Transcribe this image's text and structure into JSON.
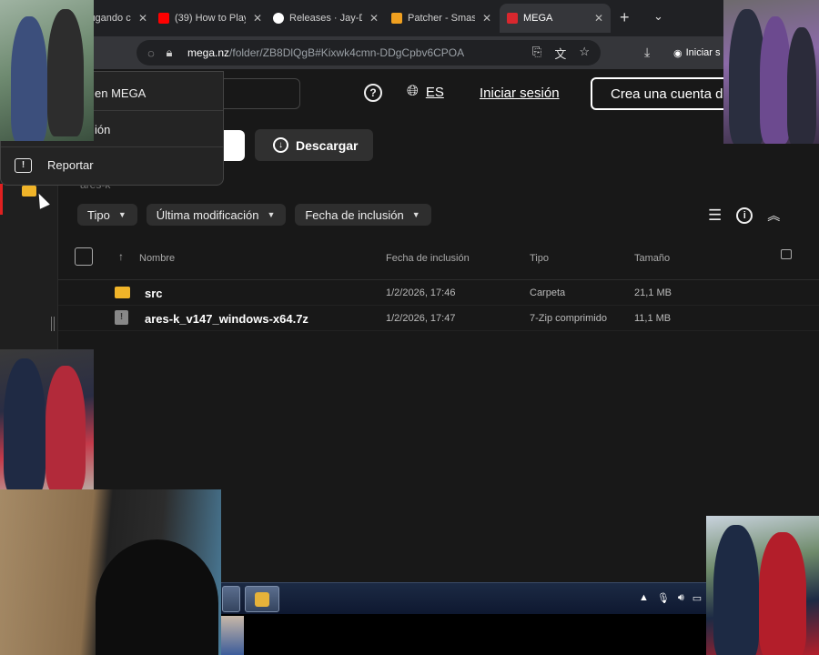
{
  "browser": {
    "tabs": [
      {
        "label": "jugando co",
        "favicon_color": "#3a3a3a"
      },
      {
        "label": "(39) How to Play",
        "favicon_color": "#ff0000"
      },
      {
        "label": "Releases · Jay-D",
        "favicon_color": "#ffffff"
      },
      {
        "label": "Patcher - Smash",
        "favicon_color": "#f0a020"
      },
      {
        "label": "MEGA",
        "favicon_color": "#d9272e",
        "active": true
      }
    ],
    "close_glyph": "✕",
    "new_tab_glyph": "+",
    "tab_list_glyph": "⌄",
    "address": {
      "host": "mega.nz",
      "path": "/folder/ZB8DlQgB#Kixwk4cmn-DDgCpbv6CPOA"
    },
    "signin_label": "Iniciar s"
  },
  "header": {
    "language_code": "ES",
    "login_label": "Iniciar sesión",
    "signup_label": "Crea una cuenta de"
  },
  "actions": {
    "download_label": "Descargar"
  },
  "breadcrumb": "ares-k",
  "filters": [
    {
      "label": "Tipo"
    },
    {
      "label": "Última modificación"
    },
    {
      "label": "Fecha de inclusión"
    }
  ],
  "table": {
    "columns": {
      "name": "Nombre",
      "date": "Fecha de inclusión",
      "type": "Tipo",
      "size": "Tamaño"
    },
    "rows": [
      {
        "name": "src",
        "date": "1/2/2026, 17:46",
        "type": "Carpeta",
        "size": "21,1 MB",
        "icon": "folder-icon"
      },
      {
        "name": "ares-k_v147_windows-x64.7z",
        "date": "1/2/2026, 17:47",
        "type": "7-Zip comprimido",
        "size": "11,1 MB",
        "icon": "file-icon"
      }
    ]
  },
  "context_menu": {
    "items": [
      {
        "label": "en MEGA"
      },
      {
        "label": "ión"
      },
      {
        "label": "Reportar"
      }
    ]
  },
  "colors": {
    "mega_red": "#d9272e",
    "folder_yellow": "#f0b429",
    "page_bg": "#181818"
  }
}
